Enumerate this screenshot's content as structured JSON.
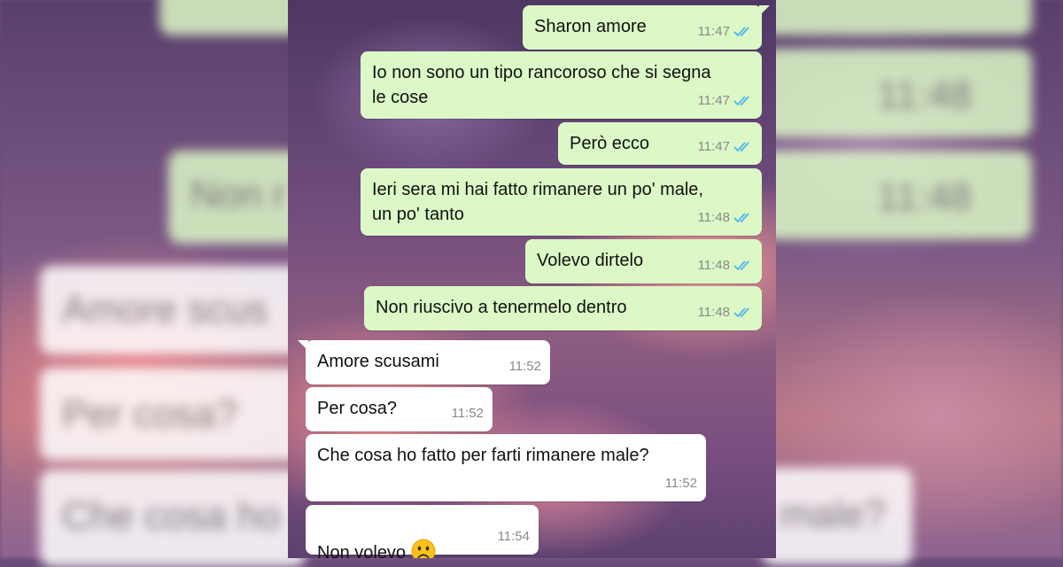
{
  "colors": {
    "outgoing_bubble": "#dcf8c6",
    "incoming_bubble": "#ffffff",
    "read_ticks": "#4fb6ec"
  },
  "messages": [
    {
      "direction": "out",
      "text": "Sharon amore",
      "time": "11:47",
      "status": "read"
    },
    {
      "direction": "out",
      "text": "Io non sono un tipo rancoroso che si segna\nle cose",
      "time": "11:47",
      "status": "read"
    },
    {
      "direction": "out",
      "text": "Però ecco",
      "time": "11:47",
      "status": "read"
    },
    {
      "direction": "out",
      "text": "Ieri sera mi hai fatto rimanere un po' male,\nun po' tanto",
      "time": "11:48",
      "status": "read"
    },
    {
      "direction": "out",
      "text": "Volevo dirtelo",
      "time": "11:48",
      "status": "read"
    },
    {
      "direction": "out",
      "text": "Non riuscivo a tenermelo dentro",
      "time": "11:48",
      "status": "read"
    },
    {
      "direction": "in",
      "text": "Amore scusami",
      "time": "11:52"
    },
    {
      "direction": "in",
      "text": "Per cosa?",
      "time": "11:52"
    },
    {
      "direction": "in",
      "text": "Che cosa ho fatto per farti rimanere male?",
      "time": "11:52"
    },
    {
      "direction": "in",
      "text": "Non volevo",
      "emoji": "frowning-face-icon",
      "time": "11:54"
    }
  ],
  "background_ghost": {
    "left_texts": [
      "Non r",
      "Amore scus",
      "Per cosa?",
      "Che cosa ho"
    ],
    "right_texts": [
      "11:48",
      "11:48",
      "male?"
    ]
  }
}
